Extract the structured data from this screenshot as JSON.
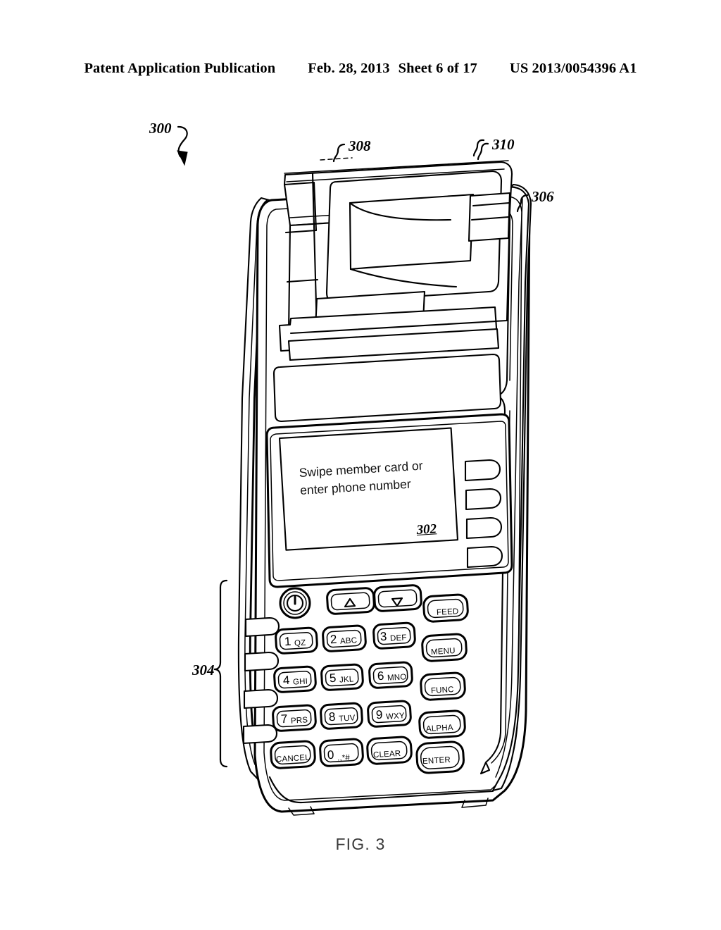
{
  "header": {
    "left": "Patent Application Publication",
    "date": "Feb. 28, 2013",
    "sheet": "Sheet 6 of 17",
    "pubnum": "US 2013/0054396 A1"
  },
  "figure": {
    "caption": "FIG. 3",
    "reference_numerals": [
      {
        "id": "300",
        "label": "300",
        "target": "point-of-sale-terminal"
      },
      {
        "id": "302",
        "label": "302",
        "target": "display-screen"
      },
      {
        "id": "304",
        "label": "304",
        "target": "keypad-assembly"
      },
      {
        "id": "306",
        "label": "306",
        "target": "housing-right-side"
      },
      {
        "id": "308",
        "label": "308",
        "target": "paper-tear-bar"
      },
      {
        "id": "310",
        "label": "310",
        "target": "antenna-stylus"
      }
    ]
  },
  "screen": {
    "line1": "Swipe member card or",
    "line2": "enter phone number",
    "ref_label": "302"
  },
  "keypad": {
    "row0": [
      {
        "name": "power",
        "digit": "",
        "letters": "",
        "word": "",
        "icon": "power-icon"
      },
      {
        "name": "up",
        "digit": "",
        "letters": "",
        "word": "",
        "icon": "triangle-up-icon"
      },
      {
        "name": "down",
        "digit": "",
        "letters": "",
        "word": "",
        "icon": "triangle-down-icon"
      },
      {
        "name": "feed",
        "digit": "",
        "letters": "",
        "word": "FEED",
        "icon": ""
      }
    ],
    "row1": [
      {
        "name": "key-1",
        "digit": "1",
        "letters": "QZ",
        "word": ""
      },
      {
        "name": "key-2",
        "digit": "2",
        "letters": "ABC",
        "word": ""
      },
      {
        "name": "key-3",
        "digit": "3",
        "letters": "DEF",
        "word": ""
      },
      {
        "name": "menu",
        "digit": "",
        "letters": "",
        "word": "MENU"
      }
    ],
    "row2": [
      {
        "name": "key-4",
        "digit": "4",
        "letters": "GHI",
        "word": ""
      },
      {
        "name": "key-5",
        "digit": "5",
        "letters": "JKL",
        "word": ""
      },
      {
        "name": "key-6",
        "digit": "6",
        "letters": "MNO",
        "word": ""
      },
      {
        "name": "func",
        "digit": "",
        "letters": "",
        "word": "FUNC"
      }
    ],
    "row3": [
      {
        "name": "key-7",
        "digit": "7",
        "letters": "PRS",
        "word": ""
      },
      {
        "name": "key-8",
        "digit": "8",
        "letters": "TUV",
        "word": ""
      },
      {
        "name": "key-9",
        "digit": "9",
        "letters": "WXY",
        "word": ""
      },
      {
        "name": "alpha",
        "digit": "",
        "letters": "",
        "word": "ALPHA"
      }
    ],
    "row4": [
      {
        "name": "cancel",
        "digit": "",
        "letters": "",
        "word": "CANCEL"
      },
      {
        "name": "key-0",
        "digit": "0",
        "letters": ".,*#",
        "word": ""
      },
      {
        "name": "clear",
        "digit": "",
        "letters": "",
        "word": "CLEAR"
      },
      {
        "name": "enter",
        "digit": "",
        "letters": "",
        "word": "ENTER"
      }
    ]
  },
  "softkeys": {
    "right_count": 4,
    "left_count": 4
  },
  "colors": {
    "ink": "#000000",
    "paper": "#ffffff"
  }
}
